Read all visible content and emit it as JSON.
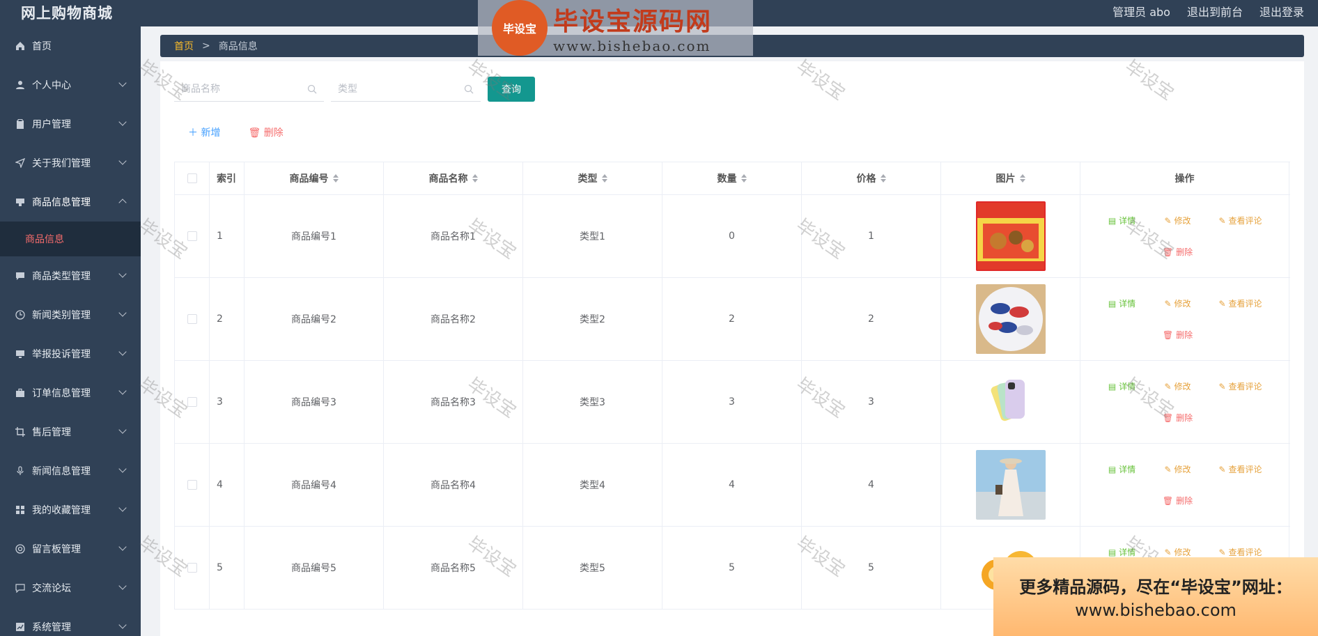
{
  "header": {
    "app_title": "网上购物商城",
    "admin_label": "管理员 abo",
    "front_label": "退出到前台",
    "logout_label": "退出登录"
  },
  "sidebar": {
    "items": [
      {
        "label": "首页",
        "icon": "home-icon",
        "expandable": false
      },
      {
        "label": "个人中心",
        "icon": "user-icon",
        "expandable": true
      },
      {
        "label": "用户管理",
        "icon": "clipboard-icon",
        "expandable": true
      },
      {
        "label": "关于我们管理",
        "icon": "send-icon",
        "expandable": true
      },
      {
        "label": "商品信息管理",
        "icon": "message-icon",
        "expandable": true,
        "expanded": true
      },
      {
        "label": "商品类型管理",
        "icon": "chat-icon",
        "expandable": true
      },
      {
        "label": "新闻类别管理",
        "icon": "clock-icon",
        "expandable": true
      },
      {
        "label": "举报投诉管理",
        "icon": "monitor-icon",
        "expandable": true
      },
      {
        "label": "订单信息管理",
        "icon": "briefcase-icon",
        "expandable": true
      },
      {
        "label": "售后管理",
        "icon": "crop-icon",
        "expandable": true
      },
      {
        "label": "新闻信息管理",
        "icon": "microphone-icon",
        "expandable": true
      },
      {
        "label": "我的收藏管理",
        "icon": "grid-icon",
        "expandable": true
      },
      {
        "label": "留言板管理",
        "icon": "help-icon",
        "expandable": true
      },
      {
        "label": "交流论坛",
        "icon": "comment-icon",
        "expandable": true
      },
      {
        "label": "系统管理",
        "icon": "chart-icon",
        "expandable": true
      }
    ],
    "submenu_active": "商品信息"
  },
  "breadcrumb": {
    "home": "首页",
    "separator": ">",
    "current": "商品信息"
  },
  "search": {
    "name_placeholder": "商品名称",
    "type_placeholder": "类型",
    "query_label": "查询"
  },
  "actions": {
    "add_label": "新增",
    "delete_label": "删除"
  },
  "table": {
    "headers": {
      "index": "索引",
      "code": "商品编号",
      "name": "商品名称",
      "type": "类型",
      "quantity": "数量",
      "price": "价格",
      "image": "图片",
      "ops": "操作"
    },
    "rows": [
      {
        "index": "1",
        "code": "商品编号1",
        "name": "商品名称1",
        "type": "类型1",
        "quantity": "0",
        "price": "1"
      },
      {
        "index": "2",
        "code": "商品编号2",
        "name": "商品名称2",
        "type": "类型2",
        "quantity": "2",
        "price": "2"
      },
      {
        "index": "3",
        "code": "商品编号3",
        "name": "商品名称3",
        "type": "类型3",
        "quantity": "3",
        "price": "3"
      },
      {
        "index": "4",
        "code": "商品编号4",
        "name": "商品名称4",
        "type": "类型4",
        "quantity": "4",
        "price": "4"
      },
      {
        "index": "5",
        "code": "商品编号5",
        "name": "商品名称5",
        "type": "类型5",
        "quantity": "5",
        "price": "5"
      }
    ],
    "ops": {
      "detail": "详情",
      "edit": "修改",
      "review": "查看评论",
      "delete": "删除"
    }
  },
  "watermark": {
    "logo_cn": "毕设宝源码网",
    "logo_badge": "毕设宝",
    "logo_url": "www.bishebao.com",
    "tile_text": "毕设宝",
    "promo_line1": "更多精品源码，尽在“毕设宝”网址：",
    "promo_line2": "www.bishebao.com"
  },
  "colors": {
    "sidebar_bg": "#304156",
    "accent_teal": "#13978f",
    "active_red": "#f56c6c",
    "breadcrumb_home": "#f7ba2a"
  }
}
